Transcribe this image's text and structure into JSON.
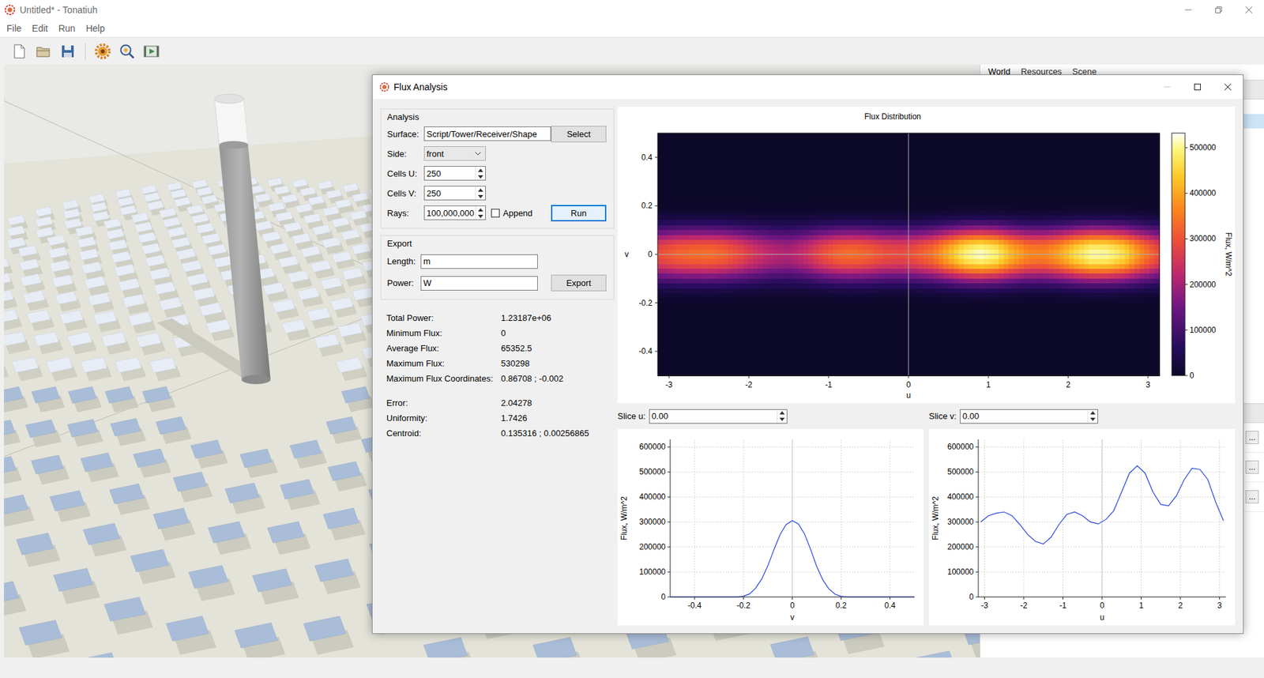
{
  "window": {
    "title": "Untitled* - Tonatiuh"
  },
  "menu": [
    {
      "label": "File"
    },
    {
      "label": "Edit"
    },
    {
      "label": "Run"
    },
    {
      "label": "Help"
    }
  ],
  "side_panel": {
    "tabs": [
      {
        "label": "World",
        "selected": true
      },
      {
        "label": "Resources",
        "selected": false
      },
      {
        "label": "Scene",
        "selected": false
      }
    ],
    "tree_rows": [
      {
        "selected": false
      },
      {
        "selected": true
      }
    ],
    "property_buttons": [
      "...",
      "...",
      "..."
    ]
  },
  "dialog": {
    "title": "Flux Analysis",
    "analysis": {
      "title": "Analysis",
      "surface": {
        "label": "Surface:",
        "value": "Script/Tower/Receiver/Shape"
      },
      "select_button": "Select",
      "side": {
        "label": "Side:",
        "value": "front"
      },
      "cells_u": {
        "label": "Cells U:",
        "value": "250"
      },
      "cells_v": {
        "label": "Cells V:",
        "value": "250"
      },
      "rays": {
        "label": "Rays:",
        "value": "100,000,000"
      },
      "append": {
        "label": "Append",
        "checked": false
      },
      "run_button": {
        "label": "Run",
        "focused": true
      }
    },
    "export": {
      "title": "Export",
      "length": {
        "label": "Length:",
        "value": "m"
      },
      "power": {
        "label": "Power:",
        "value": "W"
      },
      "export_button": "Export"
    },
    "results": [
      [
        {
          "label": "Total Power:",
          "value": "1.23187e+06"
        },
        {
          "label": "Minimum Flux:",
          "value": "0"
        },
        {
          "label": "Average Flux:",
          "value": "65352.5"
        },
        {
          "label": "Maximum Flux:",
          "value": "530298"
        },
        {
          "label": "Maximum Flux Coordinates:",
          "value": "0.86708 ; -0.002"
        }
      ],
      [
        {
          "label": "Error:",
          "value": "2.04278"
        },
        {
          "label": "Uniformity:",
          "value": "1.7426"
        },
        {
          "label": "Centroid:",
          "value": "0.135316 ; 0.00256865"
        }
      ]
    ],
    "flux_map": {
      "title": "Flux Distribution",
      "x_label": "u",
      "y_label": "v",
      "x_ticks": [
        "-3",
        "-2",
        "-1",
        "0",
        "1",
        "2",
        "3"
      ],
      "y_ticks": [
        "0.4",
        "0.2",
        "0",
        "-0.2",
        "-0.4"
      ],
      "colorbar_label": "Flux, W/m^2",
      "colorbar_ticks": [
        "0",
        "100000",
        "200000",
        "300000",
        "400000",
        "500000"
      ]
    },
    "slices": [
      {
        "label": "Slice u:",
        "value": "0.00"
      },
      {
        "label": "Slice v:",
        "value": "0.00"
      }
    ],
    "profile_v": {
      "x_label": "v",
      "y_label": "Flux, W/m^2",
      "x_ticks": [
        "-0.4",
        "-0.2",
        "0",
        "0.2",
        "0.4"
      ],
      "y_ticks": [
        "0",
        "100000",
        "200000",
        "300000",
        "400000",
        "500000",
        "600000"
      ],
      "x": [
        -0.5,
        -0.475,
        -0.45,
        -0.425,
        -0.4,
        -0.375,
        -0.35,
        -0.325,
        -0.3,
        -0.275,
        -0.25,
        -0.225,
        -0.2,
        -0.175,
        -0.15,
        -0.125,
        -0.1,
        -0.075,
        -0.05,
        -0.025,
        0,
        0.025,
        0.05,
        0.075,
        0.1,
        0.125,
        0.15,
        0.175,
        0.2,
        0.225,
        0.25,
        0.275,
        0.3,
        0.325,
        0.35,
        0.375,
        0.4,
        0.425,
        0.45,
        0.475,
        0.5
      ],
      "flux": [
        0,
        0,
        0,
        0,
        0,
        0,
        0,
        0,
        0,
        0,
        0,
        0,
        3000,
        12000,
        35000,
        72000,
        125000,
        190000,
        250000,
        290000,
        305000,
        292000,
        252000,
        190000,
        122000,
        68000,
        32000,
        11000,
        2500,
        0,
        0,
        0,
        0,
        0,
        0,
        0,
        0,
        0,
        0,
        0,
        0
      ]
    },
    "profile_u": {
      "x_label": "u",
      "y_label": "Flux, W/m^2",
      "x_ticks": [
        "-3",
        "-2",
        "-1",
        "0",
        "1",
        "2",
        "3"
      ],
      "y_ticks": [
        "0",
        "100000",
        "200000",
        "300000",
        "400000",
        "500000",
        "600000"
      ],
      "x": [
        -3.1,
        -2.9,
        -2.7,
        -2.5,
        -2.3,
        -2.1,
        -1.9,
        -1.7,
        -1.5,
        -1.3,
        -1.1,
        -0.9,
        -0.7,
        -0.5,
        -0.3,
        -0.1,
        0.1,
        0.3,
        0.5,
        0.7,
        0.9,
        1.1,
        1.3,
        1.5,
        1.7,
        1.9,
        2.1,
        2.3,
        2.5,
        2.7,
        2.9,
        3.1
      ],
      "flux": [
        300000,
        325000,
        335000,
        340000,
        325000,
        290000,
        250000,
        222000,
        212000,
        240000,
        290000,
        330000,
        340000,
        325000,
        300000,
        292000,
        310000,
        345000,
        420000,
        495000,
        525000,
        495000,
        420000,
        370000,
        365000,
        405000,
        470000,
        515000,
        510000,
        470000,
        380000,
        305000
      ]
    }
  }
}
